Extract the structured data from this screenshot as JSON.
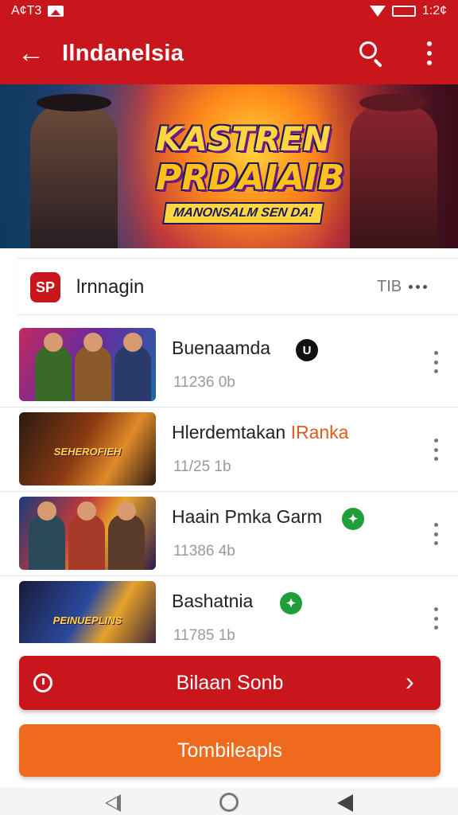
{
  "status_bar": {
    "left_text": "A¢T3",
    "right_text": "1:2¢"
  },
  "app_bar": {
    "back_icon": "←",
    "title": "Ilndanelsia"
  },
  "banner": {
    "line1": "KASTREN",
    "line2": "PRDAIAIB",
    "subtitle": "MANONSALM SEN DA!"
  },
  "section": {
    "logo_text": "SP",
    "title": "lrnnagin",
    "meta": "TIB"
  },
  "games": [
    {
      "title": "Buenaamda",
      "subtitle": "11236 0b",
      "badge": "dark",
      "badge_text": "U",
      "thumb_label": ""
    },
    {
      "title": "Hlerdemtakan ",
      "title_accent": "IRanka",
      "subtitle": "11/25 1b",
      "badge": "",
      "thumb_label": "SEHEROFIEH"
    },
    {
      "title": "Haain Pmka Garm",
      "subtitle": "11386 4b",
      "badge": "green",
      "thumb_label": ""
    },
    {
      "title": "Bashatnia",
      "subtitle": "11785 1b",
      "badge": "green",
      "thumb_label": "PEINUEPLINS"
    }
  ],
  "buttons": {
    "primary_label": "Bilaan Sonb",
    "primary_chevron": "›",
    "secondary_label": "Tombileapls"
  },
  "colors": {
    "brand_red": "#c8161c",
    "accent_orange": "#ef6a1c",
    "badge_green": "#1f9e3a"
  },
  "icons": {
    "app_bar": [
      "back-arrow-icon",
      "search-icon",
      "more-vert-icon"
    ],
    "nav_bar": [
      "nav-back-icon",
      "nav-home-icon",
      "nav-recent-icon"
    ]
  }
}
